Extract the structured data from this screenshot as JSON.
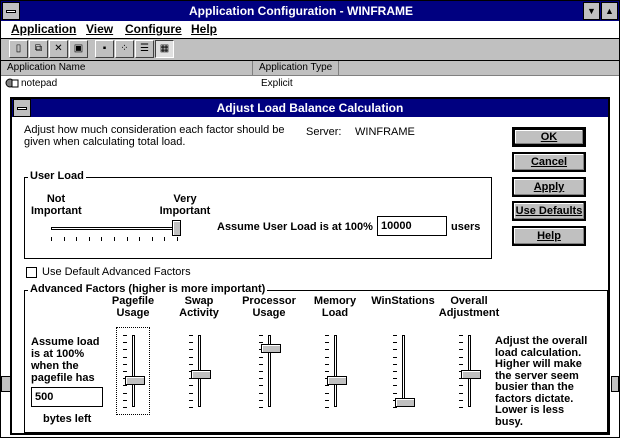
{
  "window": {
    "title": "Application Configuration - WINFRAME",
    "menu": [
      "Application",
      "View",
      "Configure",
      "Help"
    ],
    "toolbar_icons": [
      "new-icon",
      "copy-icon",
      "delete-icon",
      "properties-icon",
      "large-icons-icon",
      "small-icons-icon",
      "list-icon",
      "details-icon"
    ],
    "columns": [
      "Application Name",
      "Application Type"
    ],
    "rows": [
      {
        "name": "notepad",
        "type": "Explicit"
      }
    ]
  },
  "dialog": {
    "title": "Adjust Load Balance Calculation",
    "description_line1": "Adjust how much consideration each factor should be",
    "description_line2": "given when calculating total load.",
    "server_label": "Server:",
    "server_value": "WINFRAME",
    "buttons": {
      "ok": "OK",
      "cancel": "Cancel",
      "apply": "Apply",
      "use_defaults": "Use Defaults",
      "help": "Help"
    },
    "user_load": {
      "group_title": "User Load",
      "not_important": [
        "Not",
        "Important"
      ],
      "very_important": [
        "Very",
        "Important"
      ],
      "slider_value": 1.0,
      "assume_label": "Assume User Load is at 100%",
      "users_value": "10000",
      "users_unit": "users"
    },
    "use_default_advanced": {
      "label": "Use Default Advanced Factors",
      "checked": false
    },
    "advanced": {
      "group_title": "Advanced Factors (higher is more important)",
      "assume_text": [
        "Assume load",
        "is at 100%",
        "when the",
        "pagefile has"
      ],
      "pagefile_value": "500",
      "bytes_left": "bytes left",
      "sliders": [
        {
          "label": [
            "Pagefile",
            "Usage"
          ],
          "level": 0.35
        },
        {
          "label": [
            "Swap",
            "Activity"
          ],
          "level": 0.45
        },
        {
          "label": [
            "Processor",
            "Usage"
          ],
          "level": 0.85
        },
        {
          "label": [
            "Memory",
            "Load"
          ],
          "level": 0.35
        },
        {
          "label": [
            "WinStations"
          ],
          "level": 0.0
        },
        {
          "label": [
            "Overall",
            "Adjustment"
          ],
          "level": 0.45
        }
      ],
      "overall_text": [
        "Adjust the overall",
        "load calculation.",
        "Higher will make",
        "the server seem",
        "busier than the",
        "factors dictate.",
        "Lower is less",
        "busy."
      ]
    }
  }
}
